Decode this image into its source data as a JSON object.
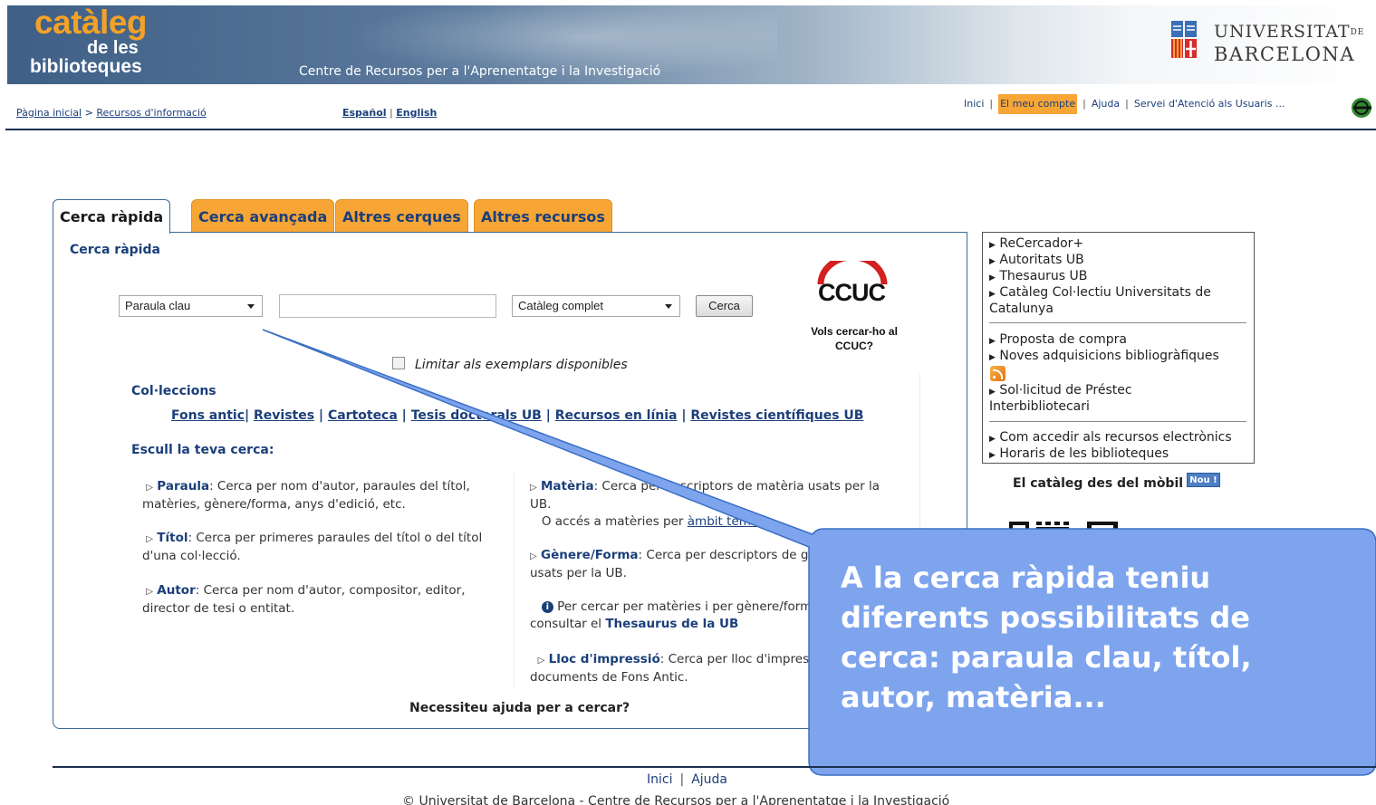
{
  "header": {
    "logo_line1": "catàleg",
    "logo_line2": "de les",
    "logo_line3": "biblioteques",
    "subtitle": "Centre de Recursos per a l'Aprenentatge i la Investigació",
    "university_line1": "UNIVERSITAT",
    "university_de": "DE",
    "university_line2": "BARCELONA"
  },
  "breadcrumb": {
    "home": "Pàgina inicial",
    "separator": ">",
    "current": "Recursos d'informació"
  },
  "languages": {
    "es": "Español",
    "sep": "|",
    "en": "English"
  },
  "topnav": {
    "items": [
      "Inici",
      "El meu compte",
      "Ajuda",
      "Servei d'Atenció als Usuaris ..."
    ],
    "active_index": 1
  },
  "tabs": [
    {
      "label": "Cerca ràpida",
      "active": true
    },
    {
      "label": "Cerca avançada",
      "active": false
    },
    {
      "label": "Altres cerques",
      "active": false
    },
    {
      "label": "Altres recursos",
      "active": false
    }
  ],
  "search": {
    "panel_title": "Cerca ràpida",
    "field_type": "Paraula clau",
    "query_value": "",
    "scope": "Catàleg complet",
    "button": "Cerca",
    "limit_label": "Limitar als exemplars disponibles",
    "limit_checked": false
  },
  "ccuc": {
    "logo": "CCUC",
    "question": "Vols cercar-ho al CCUC?"
  },
  "collections": {
    "title": "Col·leccions",
    "links": [
      "Fons antic",
      "Revistes",
      "Cartoteca",
      "Tesis doctorals UB",
      "Recursos en línia",
      "Revistes científiques UB"
    ]
  },
  "choose_search": {
    "title": "Escull la teva cerca:",
    "paraula": {
      "term": "Paraula",
      "text": ": Cerca per nom d'autor, paraules del títol, matèries, gènere/forma, anys d'edició, etc."
    },
    "titol": {
      "term": "Títol",
      "text": ": Cerca per primeres paraules del títol o del títol d'una col·lecció."
    },
    "autor": {
      "term": "Autor",
      "text": ": Cerca per nom d'autor, compositor, editor, director de tesi o entitat."
    },
    "materia": {
      "term": "Matèria",
      "text": ": Cerca per descriptors de matèria usats per la UB.",
      "sub": "O accés a matèries per",
      "sub_link": "àmbit temàtic"
    },
    "genere": {
      "term": "Gènere/Forma",
      "text": ": Cerca per descriptors de gènere i forma usats per la UB."
    },
    "thesaurus_note": {
      "text": "Per cercar per matèries i per gènere/forma podeu consultar el",
      "link": "Thesaurus de la UB"
    },
    "lloc": {
      "term": "Lloc d'impressió",
      "text": ": Cerca per lloc d'impressió dels documents de Fons Antic."
    },
    "help": "Necessiteu ajuda per a cercar?"
  },
  "sidebar": {
    "group1": [
      "ReCercador+",
      "Autoritats UB",
      "Thesaurus UB",
      "Catàleg Col·lectiu Universitats de",
      "Catalunya"
    ],
    "group2": [
      "Proposta de compra",
      "Noves adquisicions bibliogràfiques"
    ],
    "group2b": [
      "Sol·licitud de Préstec",
      "Interbibliotecari"
    ],
    "group3": [
      "Com accedir als recursos electrònics",
      "Horaris de les biblioteques"
    ],
    "mobile_title": "El catàleg des del mòbil",
    "mobile_badge": "Nou !"
  },
  "callout": {
    "text": "A la cerca ràpida teniu diferents possibilitats de cerca: paraula clau, títol, autor, matèria...",
    "fill": "#7ea4ee",
    "stroke": "#3a6fc4"
  },
  "footer": {
    "links": [
      "Inici",
      "Ajuda"
    ],
    "copyright": "© Universitat de Barcelona - Centre de Recursos per a l'Aprenentatge i la Investigació"
  }
}
